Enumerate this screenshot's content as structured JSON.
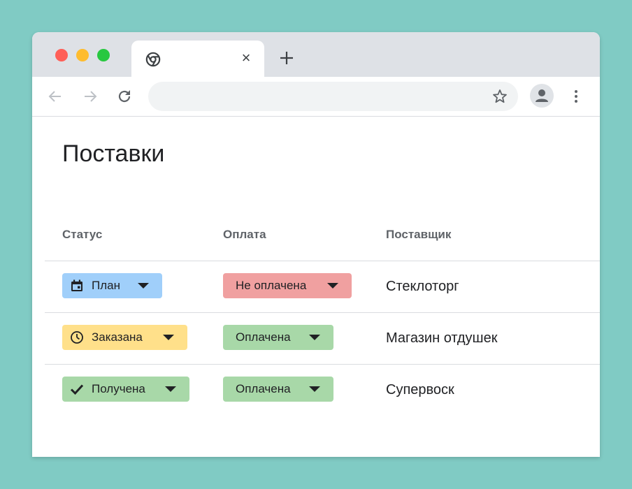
{
  "browser": {
    "tab_close_glyph": "×",
    "colors": {
      "titlebar": "#dee1e6",
      "omnibox": "#f1f3f4",
      "close": "#ff5f57",
      "minimize": "#febc2e",
      "maximize": "#28c840"
    }
  },
  "page": {
    "title": "Поставки",
    "columns": {
      "status": "Статус",
      "payment": "Оплата",
      "supplier": "Поставщик"
    },
    "rows": [
      {
        "status": {
          "label": "План",
          "icon": "calendar-icon",
          "color": "#a0cffa"
        },
        "payment": {
          "label": "Не оплачена",
          "color": "#f0a0a0"
        },
        "supplier": "Стеклоторг"
      },
      {
        "status": {
          "label": "Заказана",
          "icon": "clock-icon",
          "color": "#ffe08a"
        },
        "payment": {
          "label": "Оплачена",
          "color": "#a8d8a8"
        },
        "supplier": "Магазин отдушек"
      },
      {
        "status": {
          "label": "Получена",
          "icon": "checkmark-icon",
          "color": "#a8d8a8"
        },
        "payment": {
          "label": "Оплачена",
          "color": "#a8d8a8"
        },
        "supplier": "Супервоск"
      }
    ]
  }
}
